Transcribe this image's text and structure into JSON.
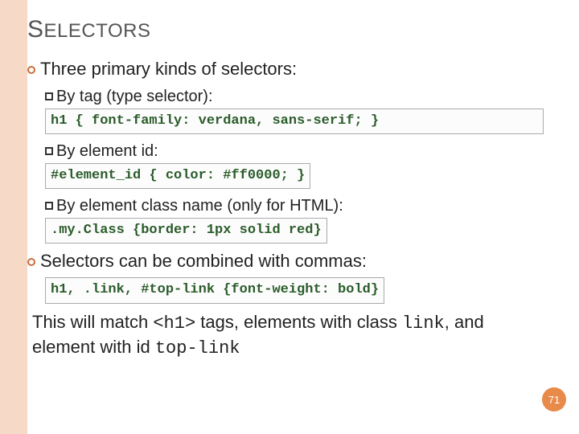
{
  "title": {
    "cap": "S",
    "rest": "ELECTORS"
  },
  "bullets": {
    "primary": "Three primary kinds of selectors:",
    "items": [
      {
        "label": "By tag (type selector):",
        "code": "h1 { font-family: verdana, sans-serif; }"
      },
      {
        "label": "By element id:",
        "code": "#element_id { color: #ff0000; }"
      },
      {
        "label": "By element class name (only for HTML):",
        "code": ".my.Class {border: 1px solid red}"
      }
    ],
    "combined": {
      "label": "Selectors can be combined with commas:",
      "code": "h1, .link, #top-link {font-weight: bold}"
    }
  },
  "explain": {
    "pre": "This will match ",
    "tag": "<h1>",
    "mid1": " tags, elements with class ",
    "cls": "link",
    "mid2": ", and element with id ",
    "idv": "top-link"
  },
  "page": "71"
}
